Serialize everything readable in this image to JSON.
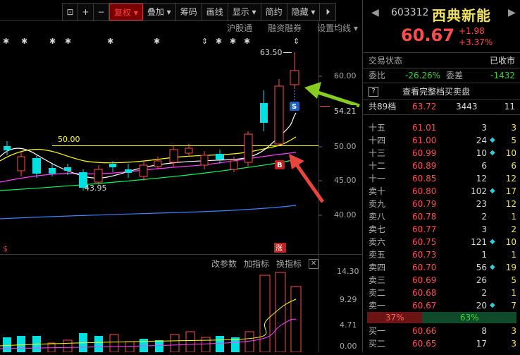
{
  "toolbar": {
    "items": [
      {
        "name": "settings-button",
        "label": "⊡"
      },
      {
        "name": "zoom-in-button",
        "label": "+"
      },
      {
        "name": "zoom-out-button",
        "label": "−"
      },
      {
        "name": "adjust-button",
        "label": "复权 ▾"
      },
      {
        "name": "overlay-button",
        "label": "叠加 ▾"
      },
      {
        "name": "chips-button",
        "label": "筹码"
      },
      {
        "name": "drawing-button",
        "label": "画线"
      },
      {
        "name": "display-button",
        "label": "显示 ▾"
      },
      {
        "name": "simple-button",
        "label": "简约"
      },
      {
        "name": "hide-button",
        "label": "隐藏 ▾"
      },
      {
        "name": "expand-button",
        "label": "⏵"
      }
    ]
  },
  "subbar": {
    "hgt": "沪股通",
    "margin": "融资融券",
    "set_ma": "设置均线 ▾"
  },
  "indicator_bar": {
    "change_params": "改参数",
    "add_indicator": "加指标",
    "switch_indicator": "换指标",
    "close": "✕"
  },
  "chart_labels": {
    "high_label": "63.50",
    "low_label": "43.95",
    "level_line": "50.00",
    "y_axis": [
      "60.00",
      "50.00",
      "45.00",
      "40.00"
    ],
    "last_price_tag": "54.21",
    "sub_axis": [
      "14.30",
      "9.29",
      "4.71",
      "0.00"
    ],
    "marker_s": "S",
    "marker_b": "B",
    "limit_badge": "涨",
    "dollar_mark": "$"
  },
  "colors": {
    "up": "#ff4d4d",
    "down": "#00e0e0",
    "ma5": "#ffffff",
    "ma10": "#ffff00",
    "ma20": "#ff40ff",
    "ma60": "#00ff60",
    "ma120": "#4080ff",
    "annotation": "#e8453c",
    "arrow_green": "#88cc22"
  },
  "stock": {
    "code": "603312",
    "name": "西典新能",
    "price": "60.67",
    "change": "+1.98",
    "change_pct": "+3.37%",
    "status_label": "交易状态",
    "status_value": "已收市",
    "wb_label": "委比",
    "wb_value": "-26.26%",
    "wc_label": "委差",
    "wc_value": "-1432",
    "help_icon": "?",
    "full_book": "查看完整档买卖盘",
    "total_levels_label": "共89档",
    "total_levels_price": "63.72",
    "total_levels_vol": "3443",
    "total_levels_cnt": "11"
  },
  "order_book": [
    {
      "label": "十五",
      "price": "61.01",
      "vol": "3",
      "cnt": "3",
      "dot": false
    },
    {
      "label": "十四",
      "price": "61.00",
      "vol": "24",
      "cnt": "5",
      "dot": true
    },
    {
      "label": "十三",
      "price": "60.99",
      "vol": "10",
      "cnt": "10",
      "dot": true
    },
    {
      "label": "十二",
      "price": "60.89",
      "vol": "6",
      "cnt": "6",
      "dot": false
    },
    {
      "label": "十一",
      "price": "60.85",
      "vol": "12",
      "cnt": "12",
      "dot": false
    },
    {
      "label": "卖十",
      "price": "60.80",
      "vol": "102",
      "cnt": "17",
      "dot": true
    },
    {
      "label": "卖九",
      "price": "60.79",
      "vol": "23",
      "cnt": "12",
      "dot": false
    },
    {
      "label": "卖八",
      "price": "60.78",
      "vol": "2",
      "cnt": "1",
      "dot": false
    },
    {
      "label": "卖七",
      "price": "60.77",
      "vol": "3",
      "cnt": "2",
      "dot": false
    },
    {
      "label": "卖六",
      "price": "60.75",
      "vol": "121",
      "cnt": "10",
      "dot": true
    },
    {
      "label": "卖五",
      "price": "60.73",
      "vol": "1",
      "cnt": "1",
      "dot": false
    },
    {
      "label": "卖四",
      "price": "60.70",
      "vol": "56",
      "cnt": "19",
      "dot": true
    },
    {
      "label": "卖三",
      "price": "60.69",
      "vol": "26",
      "cnt": "5",
      "dot": false
    },
    {
      "label": "卖二",
      "price": "60.68",
      "vol": "2",
      "cnt": "1",
      "dot": false
    },
    {
      "label": "卖一",
      "price": "60.67",
      "vol": "20",
      "cnt": "7",
      "dot": true
    }
  ],
  "ratio": {
    "left": "37%",
    "right": "63%",
    "left_pct": 37
  },
  "bids": [
    {
      "label": "买一",
      "price": "60.66",
      "vol": "8",
      "cnt": "3",
      "dot": false
    },
    {
      "label": "买二",
      "price": "60.65",
      "vol": "17",
      "cnt": "3",
      "dot": false
    }
  ]
}
